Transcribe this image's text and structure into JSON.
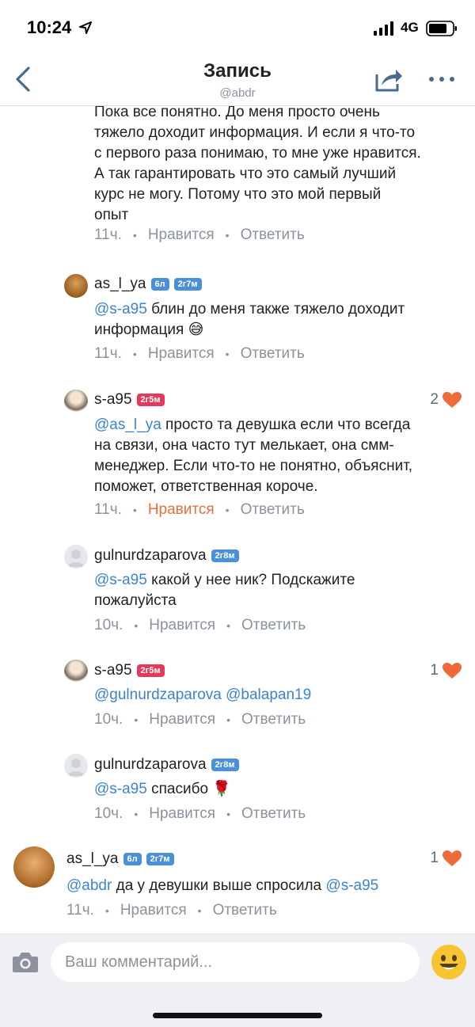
{
  "status_bar": {
    "time": "10:24",
    "network": "4G"
  },
  "header": {
    "title": "Запись",
    "subtitle": "@abdr"
  },
  "top_comment": {
    "lines": [
      "Пока все понятно. До меня просто очень",
      "тяжело доходит информация. И если я что-то",
      "с первого раза понимаю, то мне уже нравится.",
      "А так гарантировать что это самый лучший",
      "курс не могу. Потому что это мой первый",
      "опыт"
    ],
    "time": "11ч.",
    "like_label": "Нравится",
    "reply_label": "Ответить"
  },
  "comments": [
    {
      "username": "as_l_ya",
      "badge1": "6л",
      "badge2": "2г7м",
      "mention": "@s-a95",
      "text_line1": " блин до меня также тяжело доходит",
      "text_line2": "информация 😅",
      "time": "11ч.",
      "like_label": "Нравится",
      "reply_label": "Ответить"
    },
    {
      "username": "s-a95",
      "badge1": "2г5м",
      "likes": "2",
      "mention": "@as_l_ya",
      "text_line1": " просто та девушка если что всегда",
      "text_line2": "на связи, она часто тут мелькает, она смм-",
      "text_line3": "менеджер. Если что-то не понятно, объяснит,",
      "text_line4": "поможет, ответственная короче.",
      "time": "11ч.",
      "like_label": "Нравится",
      "reply_label": "Ответить"
    },
    {
      "username": "gulnurdzaparova",
      "badge1": "2г8м",
      "mention": "@s-a95",
      "text_line1": " какой у нее ник? Подскажите",
      "text_line2": "пожалуйста",
      "time": "10ч.",
      "like_label": "Нравится",
      "reply_label": "Ответить"
    },
    {
      "username": "s-a95",
      "badge1": "2г5м",
      "likes": "1",
      "mention": "@gulnurdzaparova",
      "mention2": "@balapan19",
      "time": "10ч.",
      "like_label": "Нравится",
      "reply_label": "Ответить"
    },
    {
      "username": "gulnurdzaparova",
      "badge1": "2г8м",
      "mention": "@s-a95",
      "text_line1": " спасибо 🌹",
      "time": "10ч.",
      "like_label": "Нравится",
      "reply_label": "Ответить"
    },
    {
      "username": "as_l_ya",
      "badge1": "6л",
      "badge2": "2г7м",
      "likes": "1",
      "mention": "@abdr",
      "text_mid": " да у девушки выше спросила ",
      "mention2": "@s-a95",
      "time": "11ч.",
      "like_label": "Нравится",
      "reply_label": "Ответить"
    }
  ],
  "composer": {
    "placeholder": "Ваш комментарий..."
  },
  "colors": {
    "accent": "#3d84cc",
    "liked": "#e3703b",
    "heart": "#ee6a3a",
    "badge_blue": "#4a90d9",
    "badge_red": "#e23a5a"
  }
}
